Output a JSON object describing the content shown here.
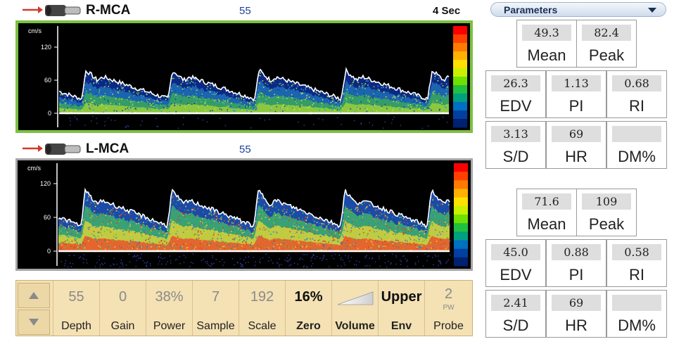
{
  "channels": [
    {
      "title": "R-MCA",
      "depth": "55",
      "time": "4 Sec",
      "axis_unit": "cm/s",
      "ticks": [
        "120",
        "60",
        "0"
      ],
      "frame_color": "#7cc142"
    },
    {
      "title": "L-MCA",
      "depth": "55",
      "time": "",
      "axis_unit": "cm/s",
      "ticks": [
        "120",
        "60",
        "0"
      ],
      "frame_color": "#a6a6a6"
    }
  ],
  "controls": [
    {
      "value": "55",
      "label": "Depth",
      "value_style": "gray"
    },
    {
      "value": "0",
      "label": "Gain",
      "value_style": "gray"
    },
    {
      "value": "38%",
      "label": "Power",
      "value_style": "gray"
    },
    {
      "value": "7",
      "label": "Sample",
      "value_style": "gray"
    },
    {
      "value": "192",
      "label": "Scale",
      "value_style": "gray"
    },
    {
      "value": "16%",
      "label": "Zero",
      "value_style": "dark"
    },
    {
      "value": "",
      "label": "Volume",
      "value_style": "dark"
    },
    {
      "value": "Upper",
      "label": "Env",
      "value_style": "dark"
    },
    {
      "value": "2",
      "sub": "PW",
      "label": "Probe",
      "value_style": "gray"
    }
  ],
  "parameters": {
    "header": "Parameters",
    "upper": {
      "mean": {
        "label": "Mean",
        "value": "49.3"
      },
      "peak": {
        "label": "Peak",
        "value": "82.4"
      },
      "edv": {
        "label": "EDV",
        "value": "26.3"
      },
      "pi": {
        "label": "PI",
        "value": "1.13"
      },
      "ri": {
        "label": "RI",
        "value": "0.68"
      },
      "sd": {
        "label": "S/D",
        "value": "3.13"
      },
      "hr": {
        "label": "HR",
        "value": "69"
      },
      "dm": {
        "label": "DM%",
        "value": ""
      }
    },
    "lower": {
      "mean": {
        "label": "Mean",
        "value": "71.6"
      },
      "peak": {
        "label": "Peak",
        "value": "109"
      },
      "edv": {
        "label": "EDV",
        "value": "45.0"
      },
      "pi": {
        "label": "PI",
        "value": "0.88"
      },
      "ri": {
        "label": "RI",
        "value": "0.58"
      },
      "sd": {
        "label": "S/D",
        "value": "2.41"
      },
      "hr": {
        "label": "HR",
        "value": "69"
      },
      "dm": {
        "label": "DM%",
        "value": ""
      }
    }
  },
  "colors": {
    "accent_green": "#7cc142",
    "panel_tan": "#f4e1b4",
    "probe_arrow_red": "#d23a2a"
  }
}
